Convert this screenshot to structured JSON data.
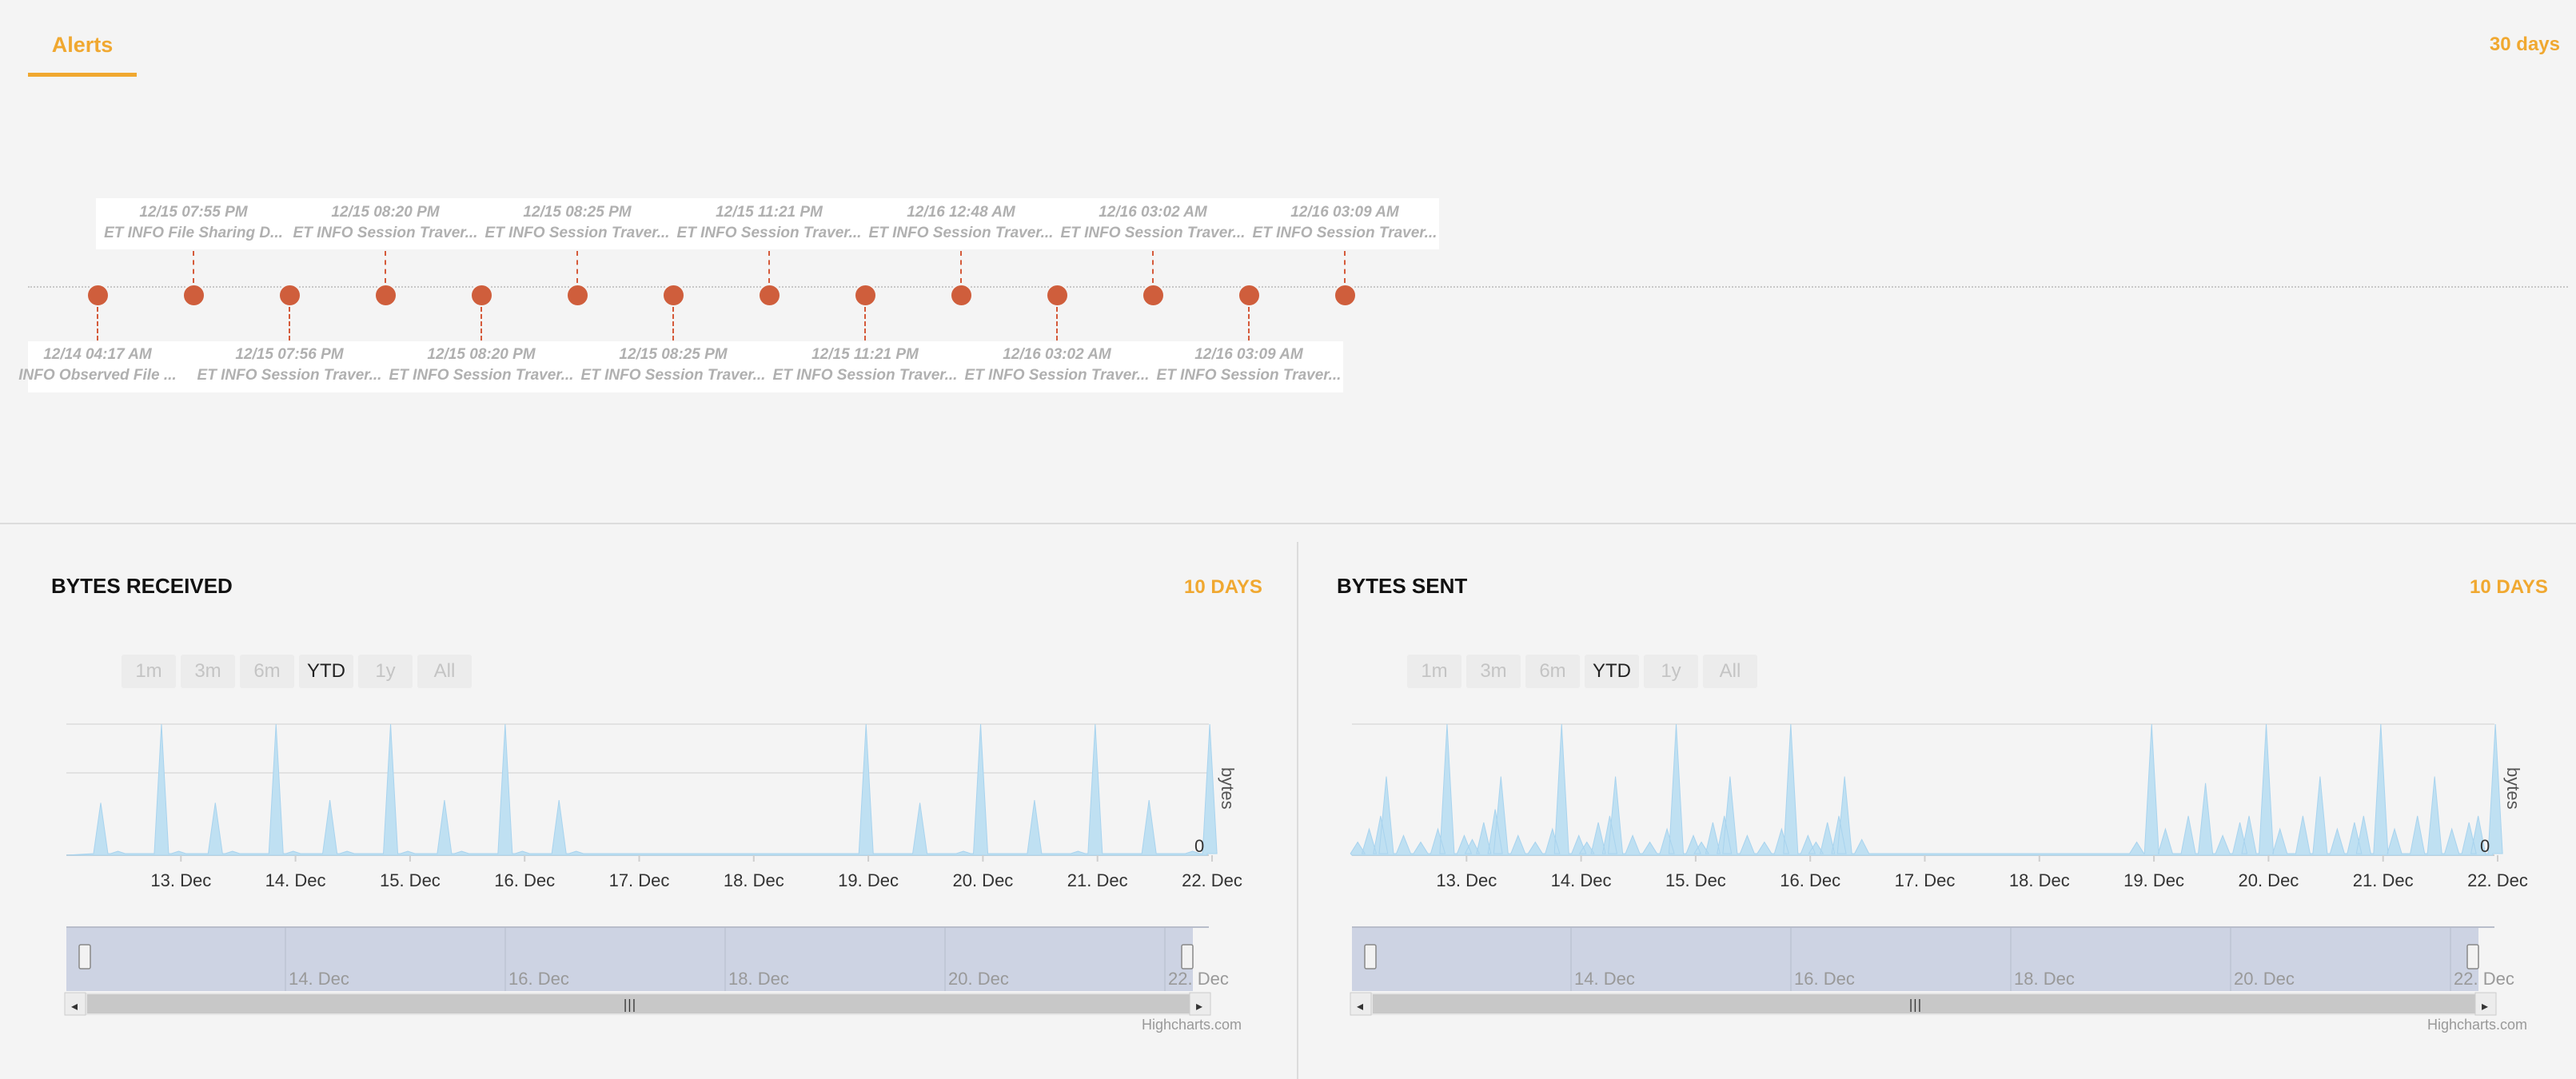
{
  "alerts": {
    "tab_label": "Alerts",
    "range_label": "30 days",
    "top_labels": [
      {
        "time": "12/15 07:55 PM",
        "text": "ET INFO File Sharing D..."
      },
      {
        "time": "12/15 08:20 PM",
        "text": "ET INFO Session Traver..."
      },
      {
        "time": "12/15 08:25 PM",
        "text": "ET INFO Session Traver..."
      },
      {
        "time": "12/15 11:21 PM",
        "text": "ET INFO Session Traver..."
      },
      {
        "time": "12/16 12:48 AM",
        "text": "ET INFO Session Traver..."
      },
      {
        "time": "12/16 03:02 AM",
        "text": "ET INFO Session Traver..."
      },
      {
        "time": "12/16 03:09 AM",
        "text": "ET INFO Session Traver..."
      }
    ],
    "bottom_labels": [
      {
        "time": "12/14 04:17 AM",
        "text": "INFO Observed File ..."
      },
      {
        "time": "12/15 07:56 PM",
        "text": "ET INFO Session Traver..."
      },
      {
        "time": "12/15 08:20 PM",
        "text": "ET INFO Session Traver..."
      },
      {
        "time": "12/15 08:25 PM",
        "text": "ET INFO Session Traver..."
      },
      {
        "time": "12/15 11:21 PM",
        "text": "ET INFO Session Traver..."
      },
      {
        "time": "12/16 03:02 AM",
        "text": "ET INFO Session Traver..."
      },
      {
        "time": "12/16 03:09 AM",
        "text": "ET INFO Session Traver..."
      }
    ]
  },
  "range_buttons": [
    "1m",
    "3m",
    "6m",
    "YTD",
    "1y",
    "All"
  ],
  "selected_range": "YTD",
  "credit": "Highcharts.com",
  "bytes_received": {
    "title": "BYTES RECEIVED",
    "range_label": "10 DAYS",
    "y_axis_title": "bytes",
    "y_zero_label": "0",
    "x_ticks": [
      "13. Dec",
      "14. Dec",
      "15. Dec",
      "16. Dec",
      "17. Dec",
      "18. Dec",
      "19. Dec",
      "20. Dec",
      "21. Dec",
      "22. Dec"
    ],
    "navigator_ticks": [
      "14. Dec",
      "16. Dec",
      "18. Dec",
      "20. Dec",
      "22. Dec"
    ]
  },
  "bytes_sent": {
    "title": "BYTES SENT",
    "range_label": "10 DAYS",
    "y_axis_title": "bytes",
    "y_zero_label": "0",
    "x_ticks": [
      "13. Dec",
      "14. Dec",
      "15. Dec",
      "16. Dec",
      "17. Dec",
      "18. Dec",
      "19. Dec",
      "20. Dec",
      "21. Dec",
      "22. Dec"
    ],
    "navigator_ticks": [
      "14. Dec",
      "16. Dec",
      "18. Dec",
      "20. Dec",
      "22. Dec"
    ]
  },
  "colors": {
    "accent": "#f0a830",
    "alert_dot": "#cf5e3c",
    "area_fill": "#bfe0f2",
    "navigator_mask": "#cdd3e3"
  },
  "chart_data": [
    {
      "type": "area",
      "title": "BYTES RECEIVED",
      "ylabel": "bytes",
      "x": [
        12.3,
        12.45,
        12.83,
        12.98,
        13.3,
        13.45,
        13.83,
        13.98,
        14.3,
        14.45,
        14.83,
        14.98,
        15.3,
        15.45,
        15.83,
        15.98,
        16.3,
        16.45,
        18.98,
        19.45,
        19.83,
        19.98,
        20.45,
        20.83,
        20.98,
        21.45,
        21.83,
        21.98
      ],
      "values": [
        0.4,
        0.03,
        1.0,
        0.03,
        0.4,
        0.03,
        1.0,
        0.03,
        0.42,
        0.03,
        1.0,
        0.03,
        0.42,
        0.03,
        1.0,
        0.03,
        0.42,
        0.03,
        1.0,
        0.4,
        0.03,
        1.0,
        0.42,
        0.03,
        1.0,
        0.42,
        0.03,
        1.0
      ]
    },
    {
      "type": "area",
      "title": "BYTES SENT",
      "ylabel": "bytes",
      "x": [
        12.05,
        12.15,
        12.25,
        12.3,
        12.45,
        12.6,
        12.75,
        12.83,
        12.98,
        13.05,
        13.15,
        13.25,
        13.3,
        13.45,
        13.6,
        13.75,
        13.83,
        13.98,
        14.05,
        14.15,
        14.25,
        14.3,
        14.45,
        14.6,
        14.75,
        14.83,
        14.98,
        15.05,
        15.15,
        15.25,
        15.3,
        15.45,
        15.6,
        15.75,
        15.83,
        15.98,
        16.05,
        16.15,
        16.25,
        16.3,
        16.45,
        18.85,
        18.98,
        19.1,
        19.3,
        19.45,
        19.6,
        19.75,
        19.83,
        19.98,
        20.1,
        20.3,
        20.45,
        20.6,
        20.75,
        20.83,
        20.98,
        21.1,
        21.3,
        21.45,
        21.6,
        21.75,
        21.83,
        21.98
      ],
      "values": [
        0.1,
        0.2,
        0.3,
        0.6,
        0.15,
        0.1,
        0.2,
        1.0,
        0.15,
        0.12,
        0.25,
        0.35,
        0.6,
        0.15,
        0.1,
        0.2,
        1.0,
        0.15,
        0.1,
        0.25,
        0.3,
        0.6,
        0.15,
        0.1,
        0.2,
        1.0,
        0.15,
        0.1,
        0.25,
        0.3,
        0.6,
        0.15,
        0.1,
        0.2,
        1.0,
        0.15,
        0.1,
        0.25,
        0.3,
        0.6,
        0.12,
        0.1,
        1.0,
        0.2,
        0.3,
        0.55,
        0.15,
        0.25,
        0.3,
        1.0,
        0.2,
        0.3,
        0.6,
        0.2,
        0.25,
        0.3,
        1.0,
        0.2,
        0.3,
        0.6,
        0.2,
        0.25,
        0.3,
        1.0
      ]
    }
  ]
}
